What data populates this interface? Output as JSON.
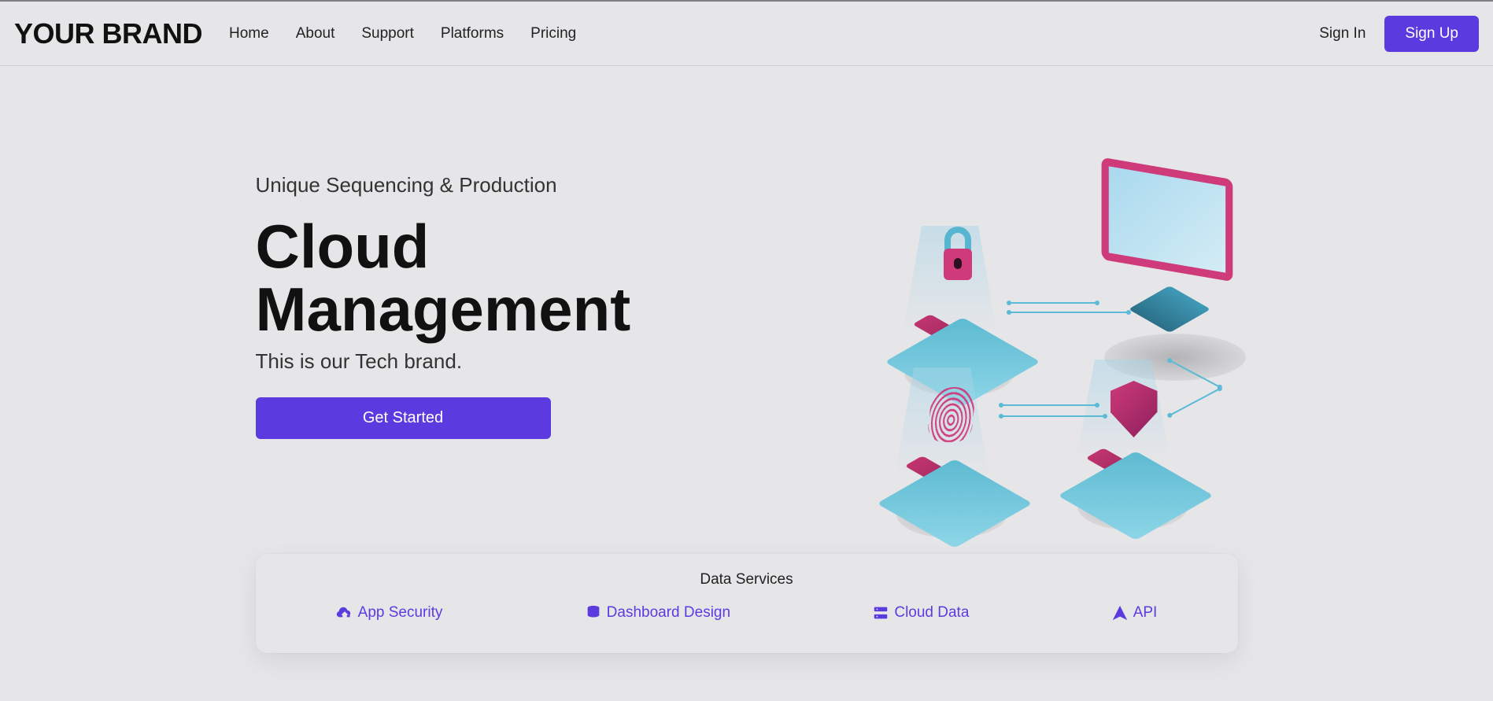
{
  "nav": {
    "brand": "YOUR BRAND",
    "links": [
      "Home",
      "About",
      "Support",
      "Platforms",
      "Pricing"
    ],
    "sign_in": "Sign In",
    "sign_up": "Sign Up"
  },
  "hero": {
    "kicker": "Unique Sequencing & Production",
    "title": "Cloud Management",
    "subtitle": "This is our Tech brand.",
    "cta": "Get Started"
  },
  "services": {
    "title": "Data Services",
    "items": [
      "App Security",
      "Dashboard Design",
      "Cloud Data",
      "API"
    ]
  },
  "illustration": {
    "elements": [
      "monitor",
      "lock",
      "fingerprint",
      "shield",
      "platforms",
      "circuit-lines"
    ]
  },
  "colors": {
    "accent": "#5b3be0",
    "bg": "#e6e6e9",
    "teal": "#5bbbd6",
    "magenta": "#ce3a7a"
  }
}
